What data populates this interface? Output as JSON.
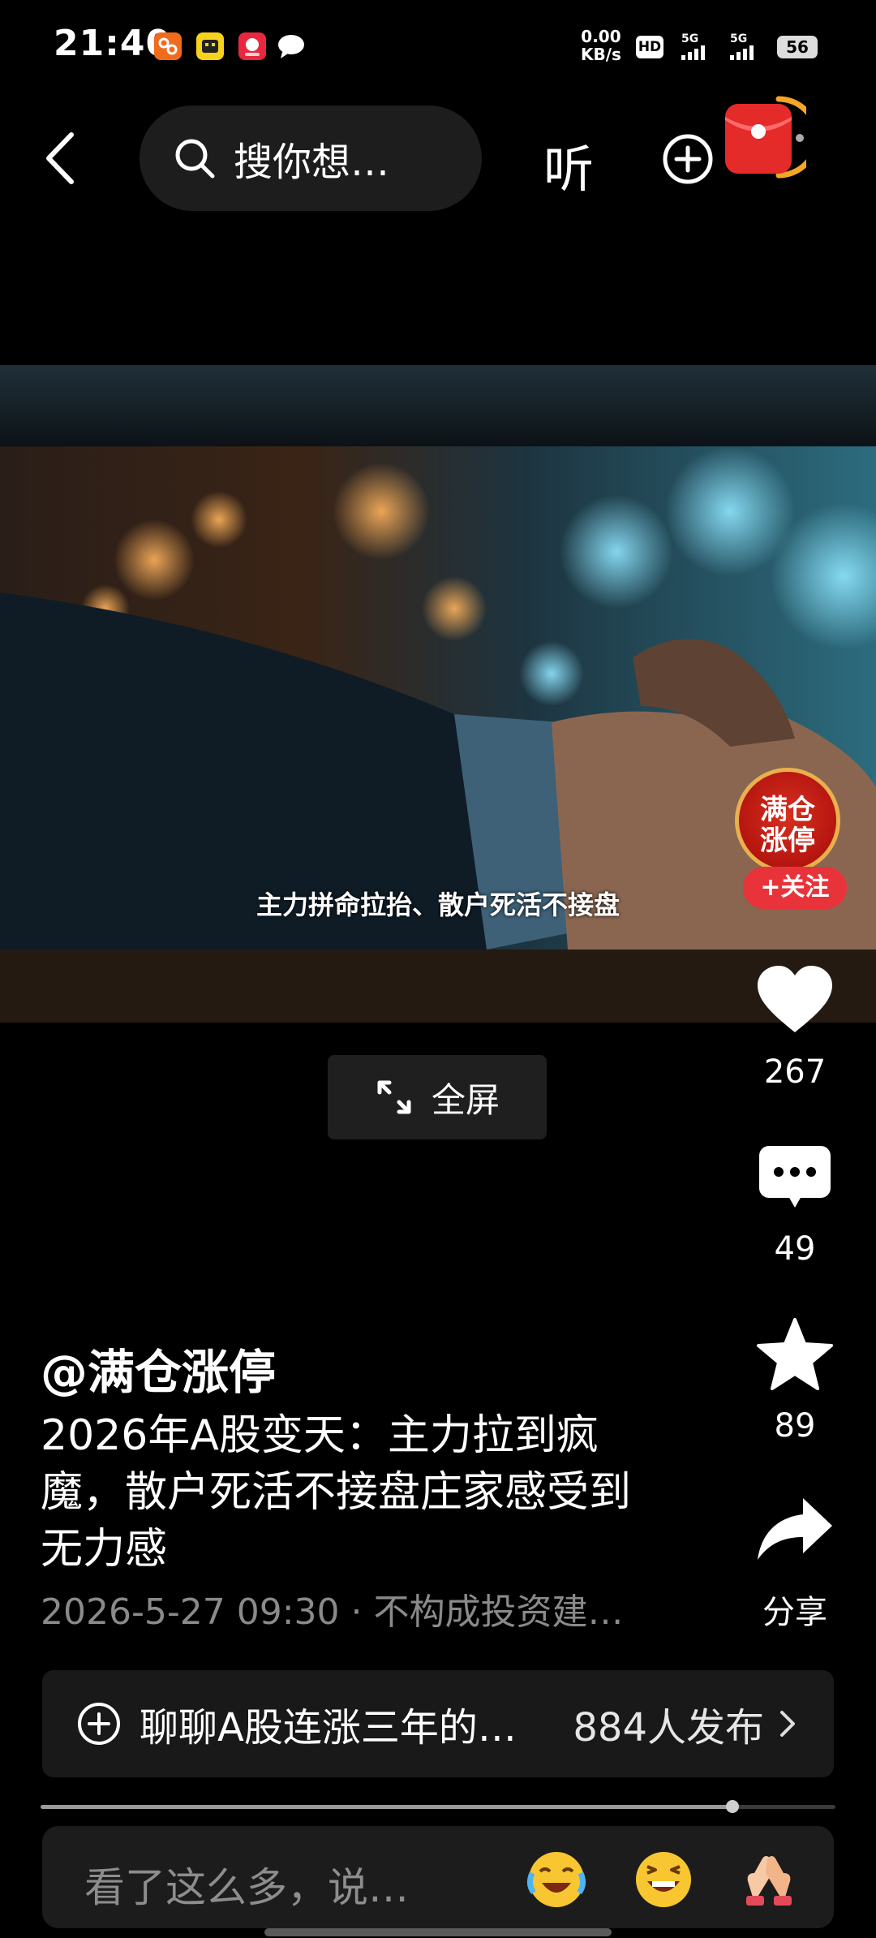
{
  "status_bar": {
    "time": "21:40",
    "net_speed_value": "0.00",
    "net_speed_unit": "KB/s",
    "hd_label": "HD",
    "sim1_label": "5G",
    "sim2_label": "5G",
    "battery": "56"
  },
  "top_bar": {
    "search_placeholder": "搜你想…",
    "listen_label": "听"
  },
  "video": {
    "subtitle": "主力拼命拉抬、散户死活不接盘",
    "creator_badge_line1": "满仓",
    "creator_badge_line2": "涨停",
    "follow_label": "+关注",
    "fullscreen_label": "全屏"
  },
  "actions": {
    "likes": "267",
    "comments": "49",
    "favorites": "89",
    "share_label": "分享"
  },
  "post": {
    "author": "@满仓涨停",
    "description": "2026年A股变天：主力拉到疯魔，散户死活不接盘庄家感受到无力感",
    "meta": "2026-5-27 09:30 · 不构成投资建…"
  },
  "topic": {
    "text": "聊聊A股连涨三年的…",
    "count": "884人发布"
  },
  "progress": {
    "played_fraction": 0.87
  },
  "comment": {
    "placeholder": "看了这么多，说…"
  }
}
